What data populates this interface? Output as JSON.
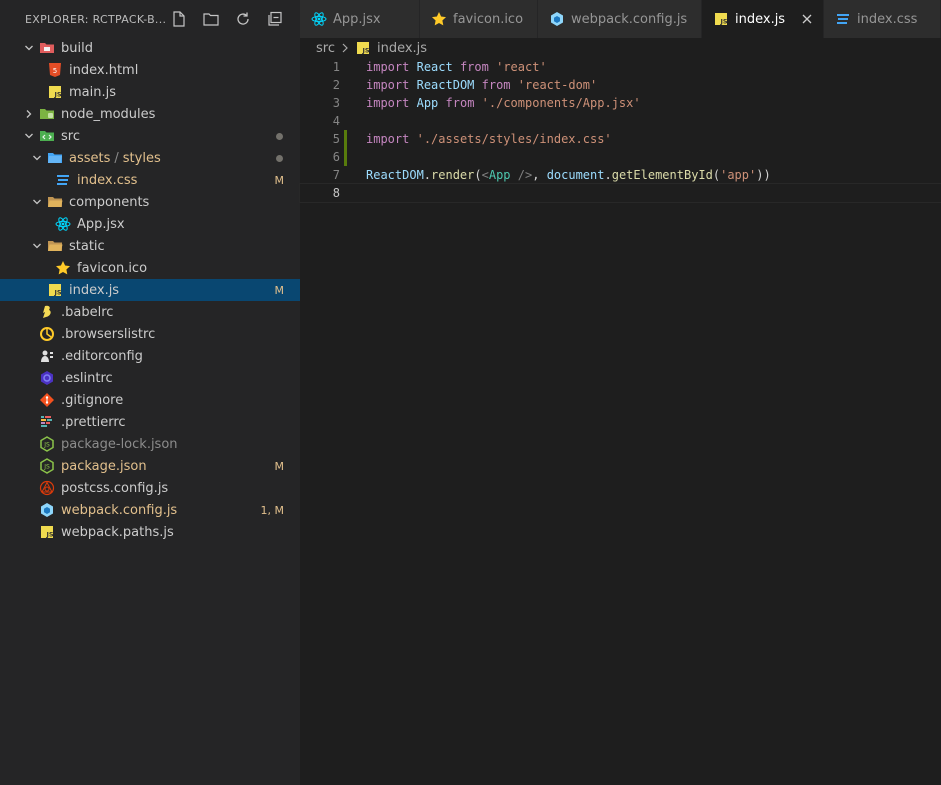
{
  "sidebar": {
    "title": "EXPLORER: RCTPACK-B...",
    "tree": [
      {
        "label": "build",
        "depth": 1,
        "type": "folder",
        "open": true,
        "icon": "folder-red-icon"
      },
      {
        "label": "index.html",
        "depth": 2,
        "type": "file",
        "icon": "html-icon"
      },
      {
        "label": "main.js",
        "depth": 2,
        "type": "file",
        "icon": "js-icon"
      },
      {
        "label": "node_modules",
        "depth": 1,
        "type": "folder",
        "open": false,
        "icon": "folder-green-icon"
      },
      {
        "label": "src",
        "depth": 1,
        "type": "folder",
        "open": true,
        "icon": "folder-src-icon",
        "dot": true
      },
      {
        "label": "assets",
        "label2": "styles",
        "depth": 2,
        "type": "folder",
        "open": true,
        "icon": "folder-blue-icon",
        "dot": true,
        "mod": true
      },
      {
        "label": "index.css",
        "depth": 3,
        "type": "file",
        "icon": "css-icon",
        "badge": "M",
        "mod": true
      },
      {
        "label": "components",
        "depth": 2,
        "type": "folder",
        "open": true,
        "icon": "folder-yellow-icon"
      },
      {
        "label": "App.jsx",
        "depth": 3,
        "type": "file",
        "icon": "react-icon"
      },
      {
        "label": "static",
        "depth": 2,
        "type": "folder",
        "open": true,
        "icon": "folder-yellow-icon"
      },
      {
        "label": "favicon.ico",
        "depth": 3,
        "type": "file",
        "icon": "star-icon"
      },
      {
        "label": "index.js",
        "depth": 2,
        "type": "file",
        "icon": "js-icon",
        "badge": "M",
        "selected": true
      },
      {
        "label": ".babelrc",
        "depth": 1,
        "type": "file",
        "icon": "babel-icon"
      },
      {
        "label": ".browserslistrc",
        "depth": 1,
        "type": "file",
        "icon": "browserslist-icon"
      },
      {
        "label": ".editorconfig",
        "depth": 1,
        "type": "file",
        "icon": "editorconfig-icon"
      },
      {
        "label": ".eslintrc",
        "depth": 1,
        "type": "file",
        "icon": "eslint-icon"
      },
      {
        "label": ".gitignore",
        "depth": 1,
        "type": "file",
        "icon": "git-icon"
      },
      {
        "label": ".prettierrc",
        "depth": 1,
        "type": "file",
        "icon": "prettier-icon"
      },
      {
        "label": "package-lock.json",
        "depth": 1,
        "type": "file",
        "icon": "nodejs-icon",
        "dim": true
      },
      {
        "label": "package.json",
        "depth": 1,
        "type": "file",
        "icon": "nodejs-icon",
        "badge": "M",
        "mod": true
      },
      {
        "label": "postcss.config.js",
        "depth": 1,
        "type": "file",
        "icon": "postcss-icon"
      },
      {
        "label": "webpack.config.js",
        "depth": 1,
        "type": "file",
        "icon": "webpack-icon",
        "badge": "1, M",
        "mod": true
      },
      {
        "label": "webpack.paths.js",
        "depth": 1,
        "type": "file",
        "icon": "js-icon"
      }
    ]
  },
  "tabs": [
    {
      "label": "App.jsx",
      "icon": "react-icon",
      "active": false
    },
    {
      "label": "favicon.ico",
      "icon": "star-icon",
      "active": false
    },
    {
      "label": "webpack.config.js",
      "icon": "webpack-icon",
      "active": false
    },
    {
      "label": "index.js",
      "icon": "js-icon",
      "active": true
    },
    {
      "label": "index.css",
      "icon": "css-icon",
      "active": false
    }
  ],
  "breadcrumb": {
    "folder": "src",
    "file": "index.js"
  },
  "editor": {
    "lines": [
      {
        "n": "1",
        "tokens": [
          [
            "kw",
            "import"
          ],
          [
            "pl",
            " "
          ],
          [
            "id",
            "React"
          ],
          [
            "pl",
            " "
          ],
          [
            "kw",
            "from"
          ],
          [
            "pl",
            " "
          ],
          [
            "str",
            "'react'"
          ]
        ]
      },
      {
        "n": "2",
        "tokens": [
          [
            "kw",
            "import"
          ],
          [
            "pl",
            " "
          ],
          [
            "id",
            "ReactDOM"
          ],
          [
            "pl",
            " "
          ],
          [
            "kw",
            "from"
          ],
          [
            "pl",
            " "
          ],
          [
            "str",
            "'react-dom'"
          ]
        ]
      },
      {
        "n": "3",
        "tokens": [
          [
            "kw",
            "import"
          ],
          [
            "pl",
            " "
          ],
          [
            "id",
            "App"
          ],
          [
            "pl",
            " "
          ],
          [
            "kw",
            "from"
          ],
          [
            "pl",
            " "
          ],
          [
            "str",
            "'./components/App.jsx'"
          ]
        ]
      },
      {
        "n": "4",
        "tokens": []
      },
      {
        "n": "5",
        "tokens": [
          [
            "kw",
            "import"
          ],
          [
            "pl",
            " "
          ],
          [
            "str",
            "'./assets/styles/index.css'"
          ]
        ],
        "added": true
      },
      {
        "n": "6",
        "tokens": [],
        "added": true
      },
      {
        "n": "7",
        "tokens": [
          [
            "id",
            "ReactDOM"
          ],
          [
            "pl",
            "."
          ],
          [
            "fn",
            "render"
          ],
          [
            "pl",
            "("
          ],
          [
            "punct",
            "<"
          ],
          [
            "cls",
            "App"
          ],
          [
            "pl",
            " "
          ],
          [
            "punct",
            "/>"
          ],
          [
            "pl",
            ", "
          ],
          [
            "id",
            "document"
          ],
          [
            "pl",
            "."
          ],
          [
            "fn",
            "getElementById"
          ],
          [
            "pl",
            "("
          ],
          [
            "str",
            "'app'"
          ],
          [
            "pl",
            "))"
          ]
        ]
      },
      {
        "n": "8",
        "tokens": [],
        "current": true
      }
    ]
  }
}
